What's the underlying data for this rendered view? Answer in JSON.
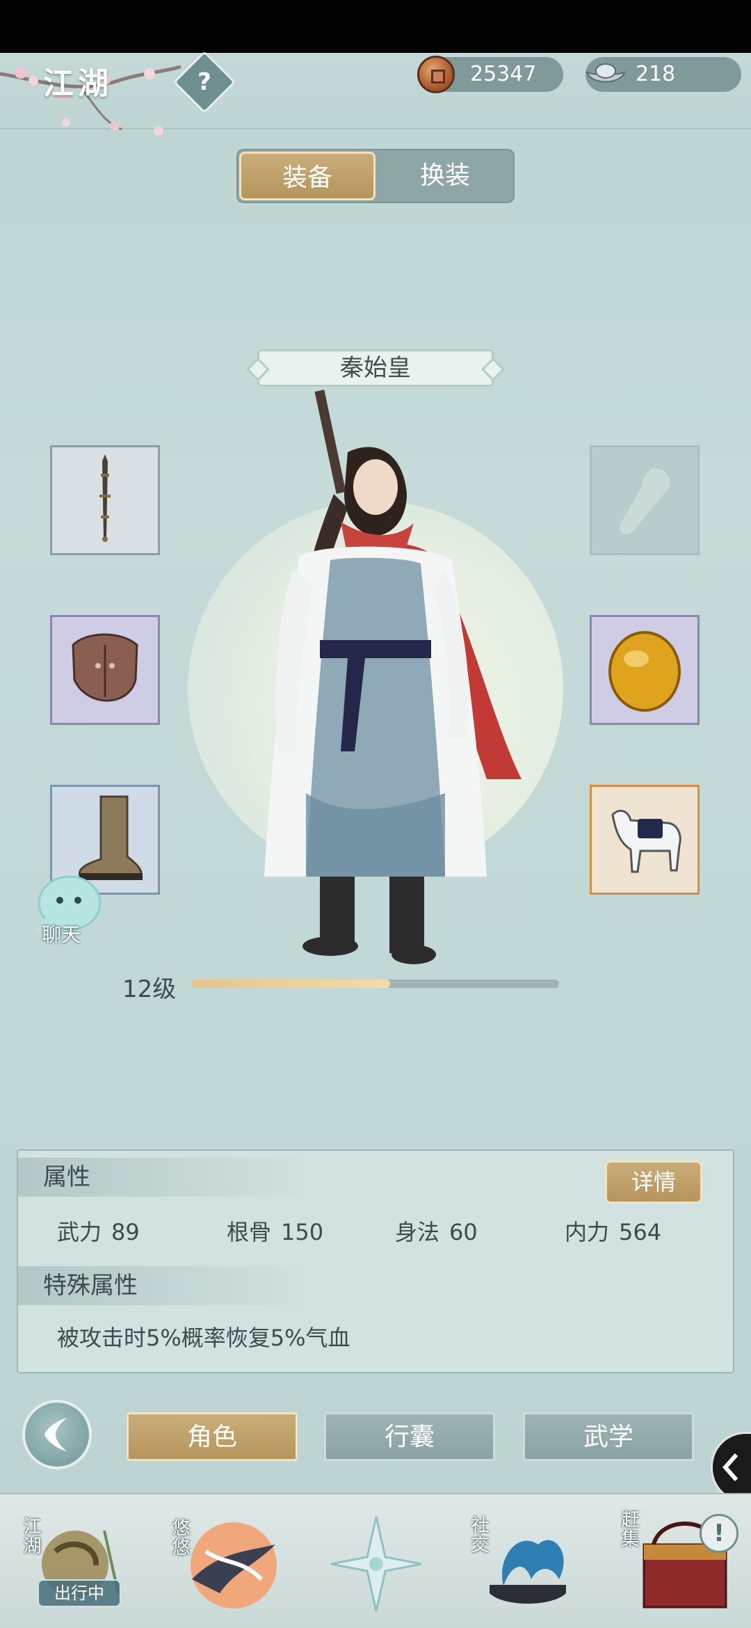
{
  "header": {
    "title": "江湖",
    "help_icon": "question-icon",
    "copper_icon": "copper-coin-icon",
    "copper": "25347",
    "silver_icon": "silver-ingot-icon",
    "silver": "218"
  },
  "tabs": {
    "equip": "装备",
    "outfit": "换装",
    "active": "装备"
  },
  "character": {
    "name": "秦始皇",
    "level_text": "12级",
    "level_progress": 0.54
  },
  "equipment_slots": {
    "left": [
      {
        "icon": "dagger-icon",
        "rarity": "common"
      },
      {
        "icon": "leather-armor-icon",
        "rarity": "purple"
      },
      {
        "icon": "boot-icon",
        "rarity": "blue"
      }
    ],
    "right": [
      {
        "icon": "scroll-bracer-icon",
        "rarity": "empty"
      },
      {
        "icon": "amber-gem-icon",
        "rarity": "purple"
      },
      {
        "icon": "horse-icon",
        "rarity": "orange"
      }
    ]
  },
  "chat": {
    "label": "聊天",
    "icon": "chat-bubble-icon"
  },
  "attributes": {
    "title": "属性",
    "detail_button": "详情",
    "stats": [
      {
        "label": "武力",
        "value": "89"
      },
      {
        "label": "根骨",
        "value": "150"
      },
      {
        "label": "身法",
        "value": "60"
      },
      {
        "label": "内力",
        "value": "564"
      }
    ],
    "special_title": "特殊属性",
    "special_text": "被攻击时5%概率恢复5%气血"
  },
  "bottom_nav": {
    "back_icon": "back-arrow-icon",
    "buttons": [
      "角色",
      "行囊",
      "武学"
    ],
    "active": "角色",
    "side_icon": "chevron-left-icon"
  },
  "dock": {
    "items": [
      {
        "label": "江湖",
        "icon": "jianghu-scroll-icon"
      },
      {
        "label": "悠悠",
        "icon": "swallow-sun-icon"
      },
      {
        "label": "",
        "icon": "compass-star-icon"
      },
      {
        "label": "社交",
        "icon": "wave-bowl-icon"
      },
      {
        "label": "赶集",
        "icon": "market-basket-icon"
      }
    ],
    "status_badge": "出行中",
    "alert": "!"
  },
  "colors": {
    "background": "#c2d8d6",
    "gold_accent": "#c9ad79",
    "teal_inactive": "#8aa3a2",
    "level_fill": "#f5dba7"
  }
}
